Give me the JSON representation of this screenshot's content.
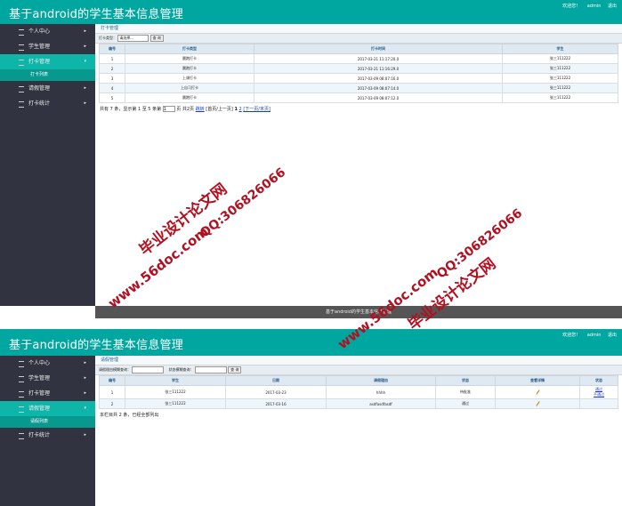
{
  "app": {
    "title": "基于android的学生基本信息管理",
    "greeting": "欢迎您！",
    "user": "admin",
    "logout": "退出",
    "footer": "基于android的学生基本信息管理"
  },
  "sidebar": {
    "items": [
      {
        "label": "个人中心"
      },
      {
        "label": "学生管理"
      },
      {
        "label": "打卡管理"
      },
      {
        "label": "请假管理"
      },
      {
        "label": "打卡统计"
      }
    ],
    "sub_checkin": "打卡列表",
    "sub_leave": "请假列表",
    "arrow": "▸",
    "arrow_open": "▾"
  },
  "checkin": {
    "panel_title": "打卡管理",
    "filter_label": "打卡类型：",
    "filter_value": "请选择...",
    "query_button": "查 询",
    "columns": [
      "编号",
      "打卡类型",
      "打卡时间",
      "学生"
    ],
    "rows": [
      [
        "1",
        "晨跑打卡",
        "2017-03-21 11:17:20.0",
        "张三111222"
      ],
      [
        "2",
        "晨跑打卡",
        "2017-03-21 11:16:29.0",
        "张三111222"
      ],
      [
        "3",
        "上课打卡",
        "2017-03-09 08:07:16.0",
        "张三111222"
      ],
      [
        "4",
        "上自习打卡",
        "2017-03-09 08:07:14.0",
        "张三111222"
      ],
      [
        "5",
        "晨跑打卡",
        "2017-03-09 08:07:12.0",
        "张三111222"
      ]
    ],
    "pager": {
      "prefix": "共有 7 条，显示第 1 至 5 条第",
      "page_value": "1",
      "suffix": "页 共2页",
      "jump": "跳转",
      "nav_text": "[首页/上一页]",
      "page1": "1",
      "page2": "2",
      "next_last": "[下一页/末页]"
    }
  },
  "leave": {
    "panel_title": "请假管理",
    "filter_label1": "请假理由模糊查询：",
    "filter_label2": "状态模糊查询：",
    "query_button": "查 询",
    "columns": [
      "编号",
      "学生",
      "日期",
      "请假理由",
      "状态",
      "查看详情",
      "状态"
    ],
    "rows": [
      {
        "id": "1",
        "student": "张三111222",
        "date": "2017-03-23",
        "reason": "hhhh",
        "status": "待批准",
        "actions": [
          "通过",
          "不通过"
        ]
      },
      {
        "id": "2",
        "student": "张三111222",
        "date": "2017-03-16",
        "reason": "asdfasdfasdf",
        "status": "通过",
        "actions": []
      }
    ],
    "summary": "本栏目共 2 条，已经全部列出"
  },
  "watermarks": {
    "site": "www.56doc.com",
    "qq": "QQ:306826066",
    "brand": "毕业设计论文网"
  },
  "colors": {
    "header": "#00a7a0",
    "sidebar": "#313440",
    "active": "#0eb6a9",
    "watermark": "#b21020"
  }
}
